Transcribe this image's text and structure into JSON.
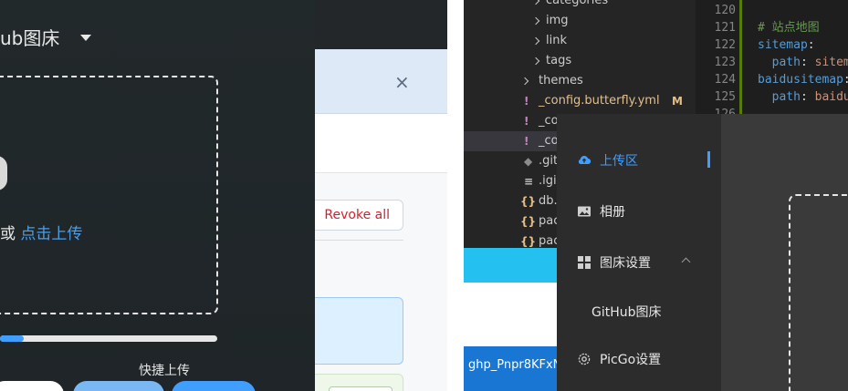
{
  "left_panel": {
    "title": "ub图床",
    "drop_prefix": "或 ",
    "drop_link": "点击上传",
    "progress": 0.11,
    "quick_upload": "快捷上传"
  },
  "dialog": {
    "close_glyph": "×",
    "revoke_label": "Revoke all"
  },
  "explorer": {
    "items": [
      {
        "label": "categories",
        "icon": "chevron-right",
        "indent": 1
      },
      {
        "label": "img",
        "icon": "chevron-right",
        "indent": 1
      },
      {
        "label": "link",
        "icon": "chevron-right",
        "indent": 1
      },
      {
        "label": "tags",
        "icon": "chevron-right",
        "indent": 1
      },
      {
        "label": "themes",
        "icon": "chevron-right",
        "indent": 0
      },
      {
        "label": "_config.butterfly.yml",
        "icon": "yaml-icon",
        "badge": "M"
      },
      {
        "label": "_co",
        "icon": "yaml-icon"
      },
      {
        "label": "_co",
        "icon": "yaml-icon",
        "selected": true
      },
      {
        "label": ".git",
        "icon": "git-icon"
      },
      {
        "label": ".igi",
        "icon": "lines-icon"
      },
      {
        "label": "db.",
        "icon": "json-icon"
      },
      {
        "label": "pac",
        "icon": "json-icon"
      },
      {
        "label": "pac",
        "icon": "json-icon"
      }
    ]
  },
  "code": {
    "lines": [
      {
        "n": "120",
        "parts": []
      },
      {
        "n": "121",
        "parts": [
          {
            "t": "# 站点地图",
            "c": "c-comment"
          }
        ]
      },
      {
        "n": "122",
        "parts": [
          {
            "t": "sitemap",
            "c": "c-key"
          },
          {
            "t": ":",
            "c": "c-plain"
          }
        ]
      },
      {
        "n": "123",
        "parts": [
          {
            "t": "  path",
            "c": "c-key"
          },
          {
            "t": ": ",
            "c": "c-plain"
          },
          {
            "t": "sitem",
            "c": "c-val"
          }
        ]
      },
      {
        "n": "124",
        "parts": [
          {
            "t": "baidusitemap",
            "c": "c-key"
          },
          {
            "t": ":",
            "c": "c-plain"
          }
        ]
      },
      {
        "n": "125",
        "parts": [
          {
            "t": "  path",
            "c": "c-key"
          },
          {
            "t": ": ",
            "c": "c-plain"
          },
          {
            "t": "baidu",
            "c": "c-val"
          }
        ]
      },
      {
        "n": "126",
        "parts": []
      }
    ]
  },
  "token_text": "ghp_Pnpr8KFxN",
  "menu": {
    "items": [
      {
        "label": "上传区",
        "icon": "upload-cloud-icon",
        "active": true
      },
      {
        "label": "相册",
        "icon": "image-icon"
      },
      {
        "label": "图床设置",
        "icon": "grid-icon"
      },
      {
        "label": "PicGo设置",
        "icon": "gear-icon"
      }
    ],
    "sub_item": "GitHub图床"
  },
  "colors": {
    "accent": "#409eff",
    "link": "#4a9fe8",
    "danger": "#cf222e"
  }
}
